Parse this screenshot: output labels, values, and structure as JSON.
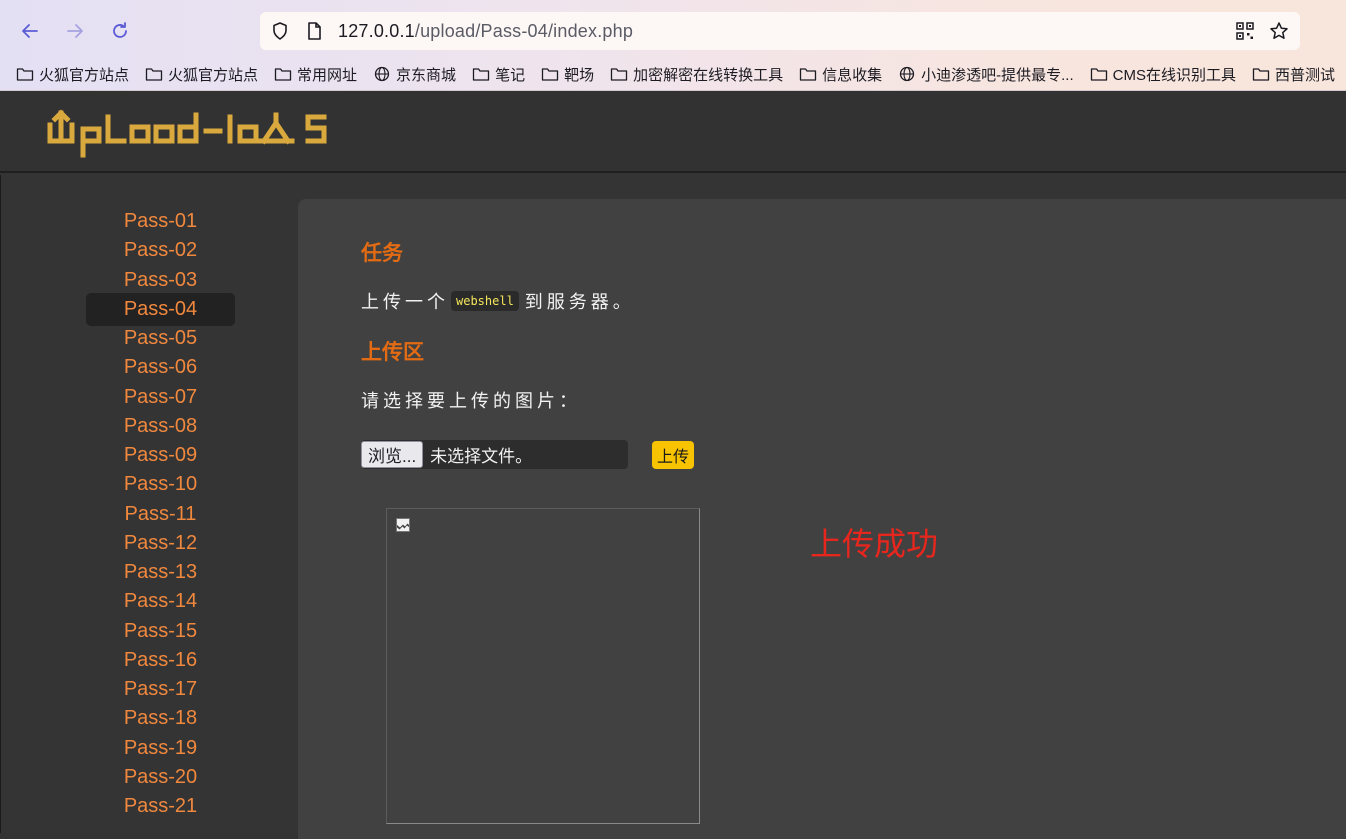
{
  "browser": {
    "url_host": "127.0.0.1",
    "url_path": "/upload/Pass-04/index.php",
    "bookmarks": [
      {
        "label": "火狐官方站点",
        "icon": "folder-icon"
      },
      {
        "label": "火狐官方站点",
        "icon": "folder-icon"
      },
      {
        "label": "常用网址",
        "icon": "folder-icon"
      },
      {
        "label": "京东商城",
        "icon": "globe-icon"
      },
      {
        "label": "笔记",
        "icon": "folder-icon"
      },
      {
        "label": "靶场",
        "icon": "folder-icon"
      },
      {
        "label": "加密解密在线转换工具",
        "icon": "folder-icon"
      },
      {
        "label": "信息收集",
        "icon": "folder-icon"
      },
      {
        "label": "小迪渗透吧-提供最专...",
        "icon": "globe-icon"
      },
      {
        "label": "CMS在线识别工具",
        "icon": "folder-icon"
      },
      {
        "label": "西普测试",
        "icon": "folder-icon"
      }
    ]
  },
  "site": {
    "logo_text": "Upload-labs",
    "logo_color": "#d9a93d"
  },
  "sidebar": {
    "active": "Pass-04",
    "items": [
      "Pass-01",
      "Pass-02",
      "Pass-03",
      "Pass-04",
      "Pass-05",
      "Pass-06",
      "Pass-07",
      "Pass-08",
      "Pass-09",
      "Pass-10",
      "Pass-11",
      "Pass-12",
      "Pass-13",
      "Pass-14",
      "Pass-15",
      "Pass-16",
      "Pass-17",
      "Pass-18",
      "Pass-19",
      "Pass-20",
      "Pass-21"
    ]
  },
  "main": {
    "task_heading": "任务",
    "task_prefix": "上传一个",
    "task_code": "webshell",
    "task_suffix": "到服务器。",
    "upload_heading": "上传区",
    "prompt": "请选择要上传的图片：",
    "browse_label": "浏览...",
    "file_status": "未选择文件。",
    "upload_button": "上传",
    "result_message": "上传成功"
  },
  "colors": {
    "accent_orange": "#e26b13",
    "sidebar_link": "#f0883e",
    "upload_button": "#f8c300",
    "success_red": "#e7261e"
  }
}
